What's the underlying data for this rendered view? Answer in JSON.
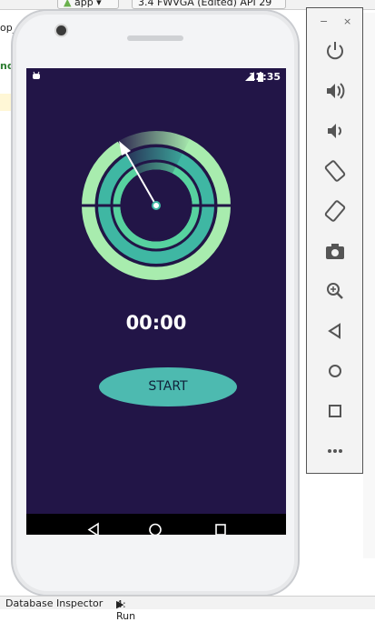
{
  "ide": {
    "run_config": "app",
    "device": "3.4  FWVGA (Edited) API 29",
    "left_labels": [
      "op_v",
      "nd"
    ],
    "bottom": {
      "tab1": "Database Inspector",
      "tab2": "4: Run"
    }
  },
  "phone": {
    "status": {
      "time": "12:35"
    },
    "app": {
      "timer": "00:00",
      "start_label": "START"
    }
  },
  "colors": {
    "screen_bg": "#221547",
    "ring_outer": "#a8ecae",
    "ring_mid": "#3fb7a3",
    "ring_inner": "#57d29f",
    "button": "#4dbab0"
  },
  "emulator_toolbar": {
    "items": [
      "power-icon",
      "volume-up-icon",
      "volume-down-icon",
      "rotate-left-icon",
      "rotate-right-icon",
      "camera-icon",
      "zoom-icon",
      "back-icon",
      "home-icon",
      "overview-icon",
      "more-icon"
    ]
  }
}
